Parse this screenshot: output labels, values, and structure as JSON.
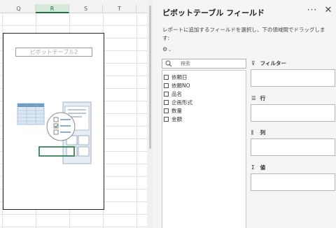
{
  "sheet": {
    "columns": [
      {
        "label": "Q",
        "selected": false
      },
      {
        "label": "R",
        "selected": true
      },
      {
        "label": "S",
        "selected": false
      },
      {
        "label": "T",
        "selected": false
      }
    ],
    "pivot_placeholder_title": "ピボットテーブル2"
  },
  "pane": {
    "title": "ピボットテーブル フィールド",
    "more_icon": "more-horizontal-icon",
    "more_glyph": "···",
    "close_icon": "close-icon",
    "close_glyph": "✕",
    "instructions": "レポートに追加するフィールドを選択し、下の領域間でドラッグします:",
    "settings_icon": "gear-icon",
    "settings_glyph": "⚙",
    "settings_chevron": "⌄",
    "search": {
      "placeholder": "検索",
      "value": ""
    },
    "fields": [
      {
        "label": "依頼日",
        "checked": false
      },
      {
        "label": "依頼NO",
        "checked": false
      },
      {
        "label": "品名",
        "checked": false
      },
      {
        "label": "企画形式",
        "checked": false
      },
      {
        "label": "数量",
        "checked": false
      },
      {
        "label": "金額",
        "checked": false
      }
    ],
    "areas": [
      {
        "label": "フィルター",
        "icon": "filter-icon",
        "glyph": "⊽"
      },
      {
        "label": "行",
        "icon": "rows-icon",
        "glyph": "☰"
      },
      {
        "label": "列",
        "icon": "columns-icon",
        "glyph": "⫼"
      },
      {
        "label": "値",
        "icon": "sigma-icon",
        "glyph": "Σ"
      }
    ]
  },
  "colors": {
    "selected_column_accent": "#217346",
    "pane_background": "#f5f5f5"
  }
}
